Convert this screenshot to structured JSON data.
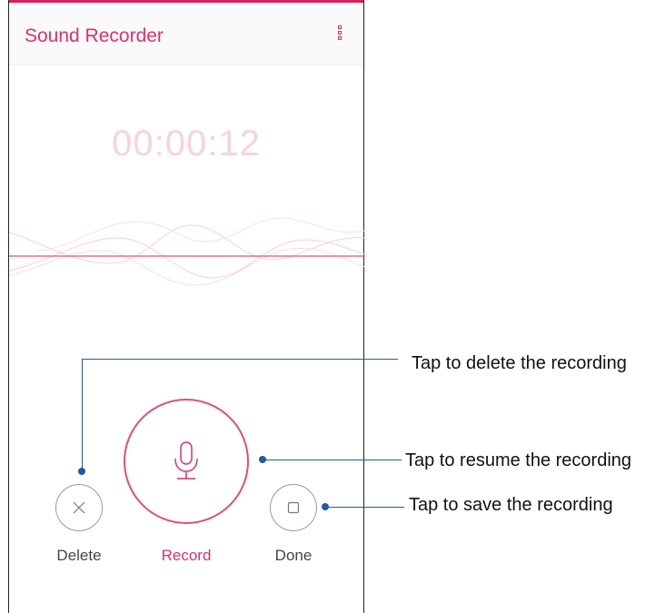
{
  "app": {
    "title": "Sound Recorder",
    "menu_icon": "overflow-menu-icon",
    "accent_color": "#e0306a"
  },
  "timer": {
    "elapsed": "00:00:12"
  },
  "controls": {
    "delete": {
      "label": "Delete",
      "icon": "close-icon"
    },
    "record": {
      "label": "Record",
      "icon": "microphone-icon"
    },
    "done": {
      "label": "Done",
      "icon": "stop-square-icon"
    }
  },
  "callouts": {
    "delete": "Tap to delete the recording",
    "record": "Tap to resume the recording",
    "done": "Tap to save the recording"
  },
  "colors": {
    "callout": "#1f5aa6",
    "waveform": "#f2c6d3",
    "baseline": "#f06b93"
  }
}
